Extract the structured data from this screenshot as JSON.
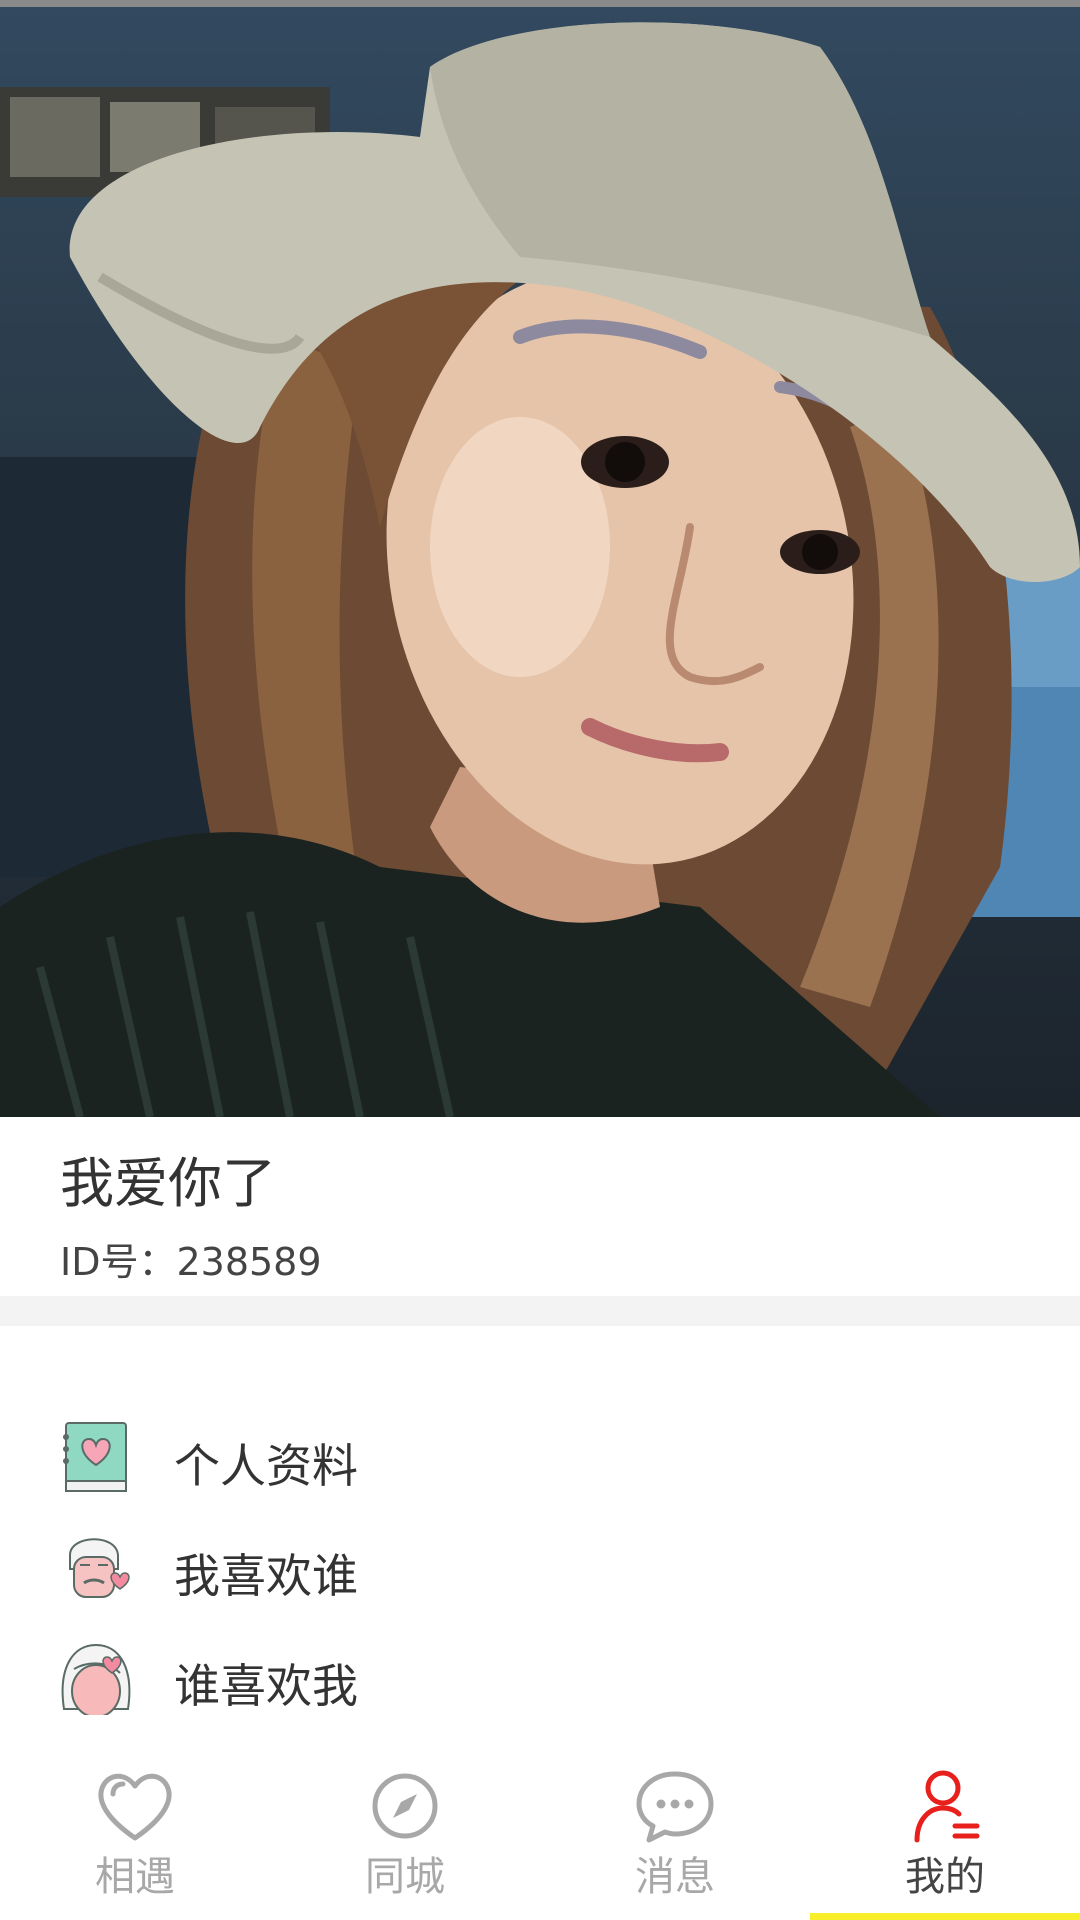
{
  "profile": {
    "nickname": "我爱你了",
    "id_text": "ID号：238589"
  },
  "menu": {
    "items": [
      {
        "label": "个人资料",
        "icon": "profile-book-icon"
      },
      {
        "label": "我喜欢谁",
        "icon": "grandpa-heart-icon"
      },
      {
        "label": "谁喜欢我",
        "icon": "girl-heart-icon"
      }
    ]
  },
  "tabs": [
    {
      "label": "相遇",
      "icon": "heart-icon",
      "active": false
    },
    {
      "label": "同城",
      "icon": "compass-icon",
      "active": false
    },
    {
      "label": "消息",
      "icon": "chat-bubble-icon",
      "active": false
    },
    {
      "label": "我的",
      "icon": "user-icon",
      "active": true
    }
  ],
  "colors": {
    "accent_red": "#e8201c",
    "indicator_yellow": "#f8ef2a",
    "inactive_tab": "#a8a8a8",
    "text": "#333333"
  }
}
